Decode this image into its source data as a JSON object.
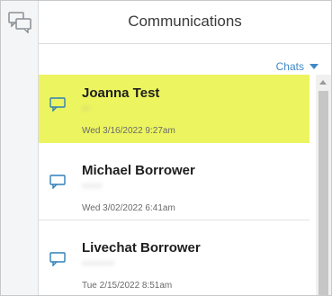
{
  "header": {
    "title": "Communications"
  },
  "rail": {
    "icon": "chat-bubbles-icon"
  },
  "filter": {
    "label": "Chats",
    "icon": "caret-down-icon"
  },
  "colors": {
    "highlight": "#ecf55f",
    "accent": "#3f88c5",
    "icon": "#2f7fb8"
  },
  "conversations": [
    {
      "name": "Joanna Test",
      "subtitle": "xx",
      "date": "Wed 3/16/2022 9:27am",
      "selected": true,
      "icon": "chat-bubble-icon"
    },
    {
      "name": "Michael Borrower",
      "subtitle": "xxxxx",
      "date": "Wed 3/02/2022 6:41am",
      "selected": false,
      "icon": "chat-bubble-icon"
    },
    {
      "name": "Livechat Borrower",
      "subtitle": "xxxxxxxx",
      "date": "Tue 2/15/2022 8:51am",
      "selected": false,
      "icon": "chat-bubble-icon"
    }
  ]
}
